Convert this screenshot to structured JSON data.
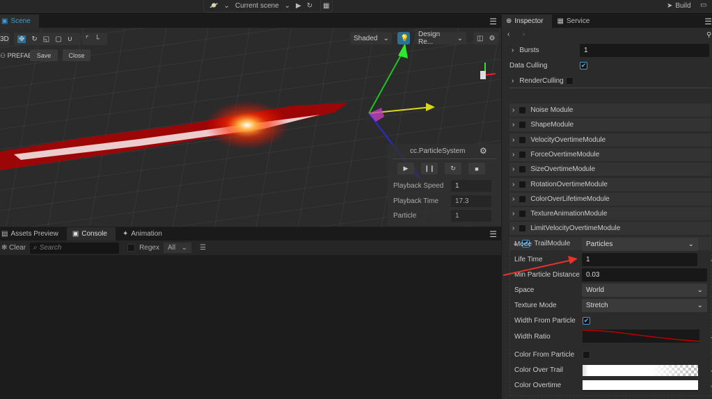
{
  "topbar": {
    "scene_select": "Current scene",
    "build_label": "Build"
  },
  "scene": {
    "tab_label": "Scene",
    "mode_3d": "3D",
    "prefab_label": "PREFAB",
    "save_label": "Save",
    "close_label": "Close",
    "shading": "Shaded",
    "resolution": "Design Re..."
  },
  "particle_panel": {
    "title": "cc.ParticleSystem",
    "rows": [
      {
        "label": "Playback Speed",
        "value": "1"
      },
      {
        "label": "Playback Time",
        "value": "17.3"
      },
      {
        "label": "Particle",
        "value": "1"
      }
    ]
  },
  "bottom": {
    "tabs": [
      {
        "label": "Assets Preview"
      },
      {
        "label": "Console"
      },
      {
        "label": "Animation"
      }
    ],
    "clear_label": "Clear",
    "search_placeholder": "Search",
    "regex_label": "Regex",
    "filter": "All"
  },
  "inspector": {
    "tabs": [
      {
        "label": "Inspector"
      },
      {
        "label": "Service"
      }
    ],
    "bursts": {
      "label": "Bursts",
      "value": "1"
    },
    "data_culling": {
      "label": "Data Culling",
      "checked": true
    },
    "render_culling": {
      "label": "RenderCulling",
      "checked": false
    },
    "modules": [
      {
        "label": "Noise Module"
      },
      {
        "label": "ShapeModule"
      },
      {
        "label": "VelocityOvertimeModule"
      },
      {
        "label": "ForceOvertimeModule"
      },
      {
        "label": "SizeOvertimeModule"
      },
      {
        "label": "RotationOvertimeModule"
      },
      {
        "label": "ColorOverLifetimeModule"
      },
      {
        "label": "TextureAnimationModule"
      },
      {
        "label": "LimitVelocityOvertimeModule"
      },
      {
        "label": "TrailModule",
        "checked": true
      }
    ],
    "trail": {
      "mode": {
        "label": "Mode",
        "value": "Particles"
      },
      "life_time": {
        "label": "Life Time",
        "value": "1"
      },
      "min_dist": {
        "label": "Min Particle Distance",
        "value": "0.03"
      },
      "space": {
        "label": "Space",
        "value": "World"
      },
      "texture_mode": {
        "label": "Texture Mode",
        "value": "Stretch"
      },
      "width_from_particle": {
        "label": "Width From Particle",
        "checked": true
      },
      "width_ratio": {
        "label": "Width Ratio"
      },
      "color_from_particle": {
        "label": "Color From Particle",
        "checked": false
      },
      "color_over_trail": {
        "label": "Color Over Trail"
      },
      "color_overtime": {
        "label": "Color Overtime"
      }
    }
  },
  "colors": {
    "accent": "#3d9bd6",
    "annotation": "#e8322a"
  }
}
